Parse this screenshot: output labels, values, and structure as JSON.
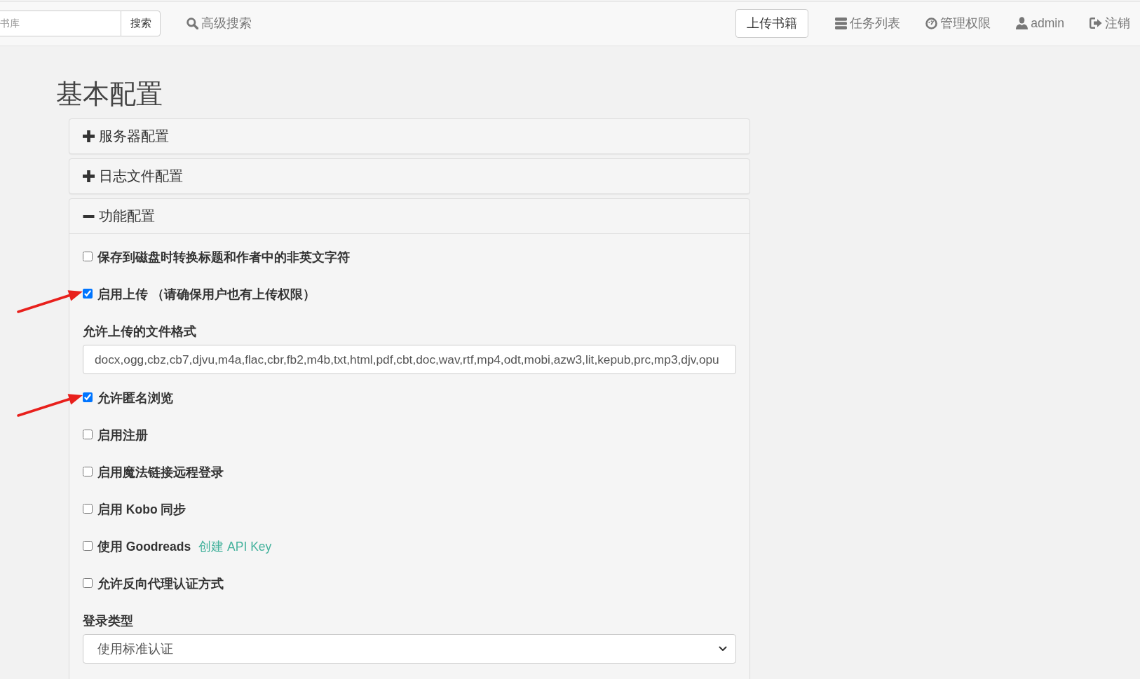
{
  "navbar": {
    "search": {
      "placeholder": "书库",
      "button": "搜索"
    },
    "advanced_search": "高级搜索",
    "upload_button": "上传书籍",
    "links": [
      "任务列表",
      "管理权限",
      "admin",
      "注销"
    ]
  },
  "page_title": "基本配置",
  "sections": [
    {
      "title": "服务器配置",
      "expanded": false
    },
    {
      "title": "日志文件配置",
      "expanded": false
    },
    {
      "title": "功能配置",
      "expanded": true,
      "fields": [
        {
          "kind": "checkbox",
          "label": "保存到磁盘时转换标题和作者中的非英文字符",
          "checked": false,
          "arrow": false
        },
        {
          "kind": "checkbox",
          "label": "启用上传 （请确保用户也有上传权限）",
          "checked": true,
          "arrow": true
        },
        {
          "kind": "text",
          "label": "允许上传的文件格式",
          "value": "docx,ogg,cbz,cb7,djvu,m4a,flac,cbr,fb2,m4b,txt,html,pdf,cbt,doc,wav,rtf,mp4,odt,mobi,azw3,lit,kepub,prc,mp3,djv,opu"
        },
        {
          "kind": "checkbox",
          "label": "允许匿名浏览",
          "checked": true,
          "arrow": true
        },
        {
          "kind": "checkbox",
          "label": "启用注册",
          "checked": false,
          "arrow": false
        },
        {
          "kind": "checkbox",
          "label": "启用魔法链接远程登录",
          "checked": false,
          "arrow": false
        },
        {
          "kind": "checkbox",
          "label": "启用 Kobo 同步",
          "checked": false,
          "arrow": false
        },
        {
          "kind": "checkbox",
          "label": "使用 Goodreads",
          "checked": false,
          "arrow": false,
          "link": "创建 API Key"
        },
        {
          "kind": "checkbox",
          "label": "允许反向代理认证方式",
          "checked": false,
          "arrow": false
        },
        {
          "kind": "select",
          "label": "登录类型",
          "value": "使用标准认证"
        }
      ]
    }
  ]
}
